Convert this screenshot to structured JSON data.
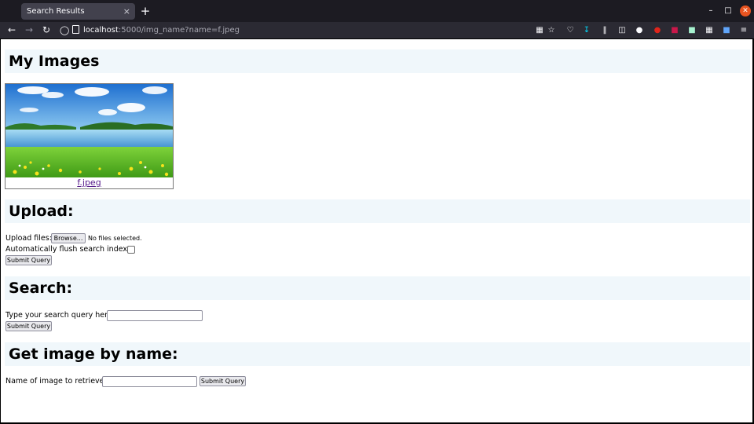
{
  "browser": {
    "tab_title": "Search Results",
    "tab_close_glyph": "×",
    "new_tab_glyph": "+",
    "url_host": "localhost",
    "url_rest": ":5000/img_name?name=f.jpeg"
  },
  "page": {
    "images_heading": "My Images",
    "images": [
      {
        "name": "f.jpeg"
      }
    ],
    "upload": {
      "heading": "Upload:",
      "files_label": "Upload files:",
      "browse_label": "Browse...",
      "no_files": "No files selected.",
      "flush_label": "Automatically flush search index?",
      "flush_checked": false,
      "submit_label": "Submit Query"
    },
    "search": {
      "heading": "Search:",
      "query_label": "Type your search query here",
      "query_value": "",
      "submit_label": "Submit Query"
    },
    "get_by_name": {
      "heading": "Get image by name:",
      "name_label": "Name of image to retrieve:",
      "name_value": "",
      "submit_label": "Submit Query"
    }
  },
  "colors": {
    "section_bg": "#f0f7fb",
    "link": "#551a8b",
    "chrome_dark": "#1c1b22",
    "toolbar": "#2b2a33",
    "close_button": "#e95420"
  },
  "icons": [
    "back-icon",
    "forward-icon",
    "reload-icon",
    "shield-icon",
    "page-icon",
    "grid-icon",
    "star-icon",
    "pocket-icon",
    "download-icon",
    "library-icon",
    "sidebar-icon",
    "extension-icons",
    "menu-icon"
  ]
}
